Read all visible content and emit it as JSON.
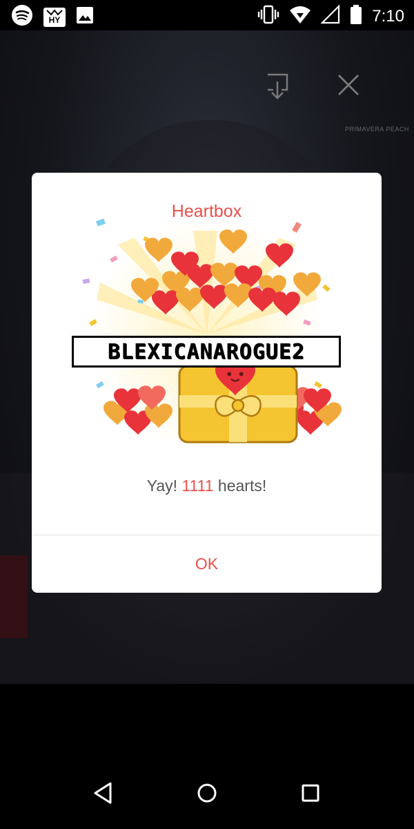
{
  "status_bar": {
    "time": "7:10",
    "left_icons": [
      "spotify-icon",
      "hy-app-icon",
      "gallery-icon"
    ],
    "right_icons": [
      "vibrate-icon",
      "wifi-icon",
      "signal-icon",
      "battery-icon"
    ],
    "hy_badge_text": "HY"
  },
  "player": {
    "icons": [
      "download-icon",
      "close-icon"
    ],
    "watermark": "PRIMAVERA PEACH"
  },
  "dialog": {
    "title": "Heartbox",
    "username_overlay": "BLEXICANAROGUE2",
    "message_prefix": "Yay!",
    "message_count": "1111",
    "message_suffix": "hearts!",
    "ok_label": "OK"
  },
  "nav_bar": {
    "buttons": [
      "back-icon",
      "home-icon",
      "recents-icon"
    ]
  },
  "colors": {
    "accent": "#e8504b",
    "heart_red": "#e8333a",
    "heart_orange": "#f2a93b",
    "box_gold": "#f4c431"
  }
}
